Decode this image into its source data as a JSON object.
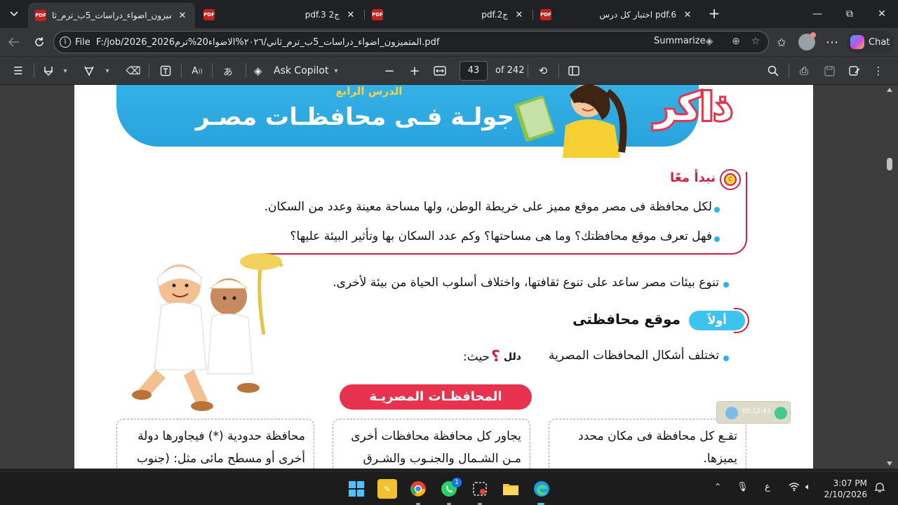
{
  "tabs": [
    {
      "title": "المتميزون_اضواء_دراسات_5ب_ترم_ثا",
      "active": true,
      "close": "✕"
    },
    {
      "title": "pdf.3 ج2",
      "active": false,
      "close": "✕"
    },
    {
      "title": "pdf.ج2",
      "active": false,
      "close": "✕"
    },
    {
      "title": "اختبار كل درس pdf.6",
      "active": false,
      "close": "✕"
    }
  ],
  "tab_icon_label": "PDF",
  "window_controls": {
    "minimize": "—",
    "maximize": "⧉",
    "close": "✕"
  },
  "address": {
    "scheme": "File",
    "url": "F:/job/2026_المتميزون_اضواء_دراسات_5ب_ترم_ثاني/٢٠٢٦%الاضواء20%ترم2026.pdf",
    "summarize_label": "Summarize",
    "chat_label": "Chat"
  },
  "pdf_toolbar": {
    "ask_copilot": "Ask Copilot",
    "page_current": "43",
    "page_total": "of 242"
  },
  "page": {
    "banner_kicker": "الدرس الرابع",
    "banner_title": "جولـة فـى محافظـات مصـر",
    "banner_badge": "ذاكر",
    "begin_title": "نبدأ معًا",
    "begin_badge_text": "C",
    "begin_lines": [
      "لكل محافظة فى مصر موقع مميز على خريطة الوطن، ولها مساحة معينة وعدد من السكان.",
      "فهل تعرف موقع محافظتك؟ وما هى مساحتها؟ وكم عدد السكان بها وتأثير البيئة عليها؟"
    ],
    "diversity_line": "تنوع بيئات مصر ساعد على تنوع ثقافتها، واختلاف أسلوب الحياة من بيئة لأخرى.",
    "section_number": "أولاً",
    "section_title": "موقع محافظتى",
    "shapes_line_prefix": "تختلف أشكال المحافظات المصرية",
    "shapes_guide": "دلل",
    "shapes_line_suffix": "حيث:",
    "red_pill": "المحافظـات المصريـة",
    "cards": [
      {
        "lines": [
          "تقـع كل محافظة فى مكان محدد",
          "يميزها."
        ]
      },
      {
        "lines": [
          "يجاور كل محافظة محافظات أخرى",
          "مـن الشـمال والجنـوب والشـرق"
        ]
      },
      {
        "lines": [
          "محافظة حدودية (*) فيجاورها دولة",
          "أخرى أو مسطح مائى مثل: (جنوب"
        ]
      }
    ]
  },
  "media_timer": "00:12:43",
  "taskbar": {
    "whatsapp_badge": "1",
    "lang": "ع",
    "time": "3:07 PM",
    "date": "2/10/2026"
  },
  "colors": {
    "accent_red": "#d41e45",
    "banner_blue": "#2aa3dc",
    "bullet_blue": "#29b6e6"
  }
}
